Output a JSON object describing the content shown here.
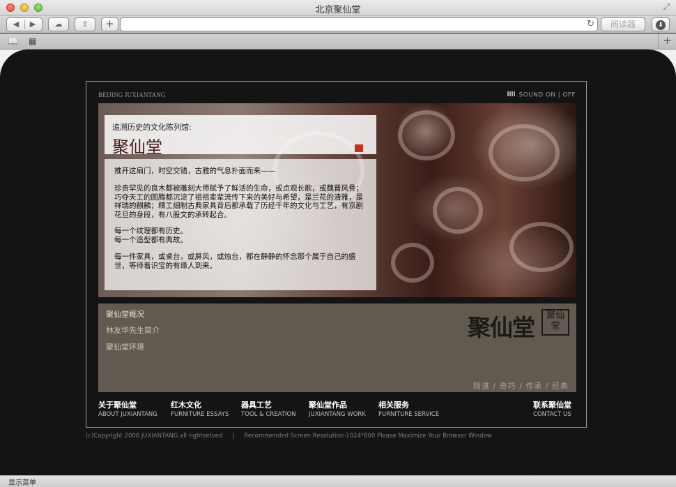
{
  "window": {
    "title": "北京聚仙堂"
  },
  "toolbar": {
    "back_icon": "◀",
    "forward_icon": "▶",
    "cloud_icon": "☁",
    "share_icon": "⇪",
    "add_icon": "+",
    "address_value": "",
    "reload_icon": "↻",
    "reader_label": "阅读器",
    "download_icon": "⬇"
  },
  "bookmarks": {
    "book_icon": "📖",
    "grid_icon": "▦",
    "newtab_icon": "+"
  },
  "site": {
    "brand_small": "BEIJING JUXIANTANG",
    "sound_label": "SOUND ON | OFF",
    "hero": {
      "subtitle": "追溯历史的文化陈列馆:",
      "title": "聚仙堂",
      "paragraphs": [
        "推开这扇门，时空交错，古雅的气息扑面而来——",
        "珍贵罕见的良木都被雕刻大师赋予了鲜活的生命，或贞观长歌，或魏晋风骨；巧夺天工的图腾都沉淀了祖祖辈辈流传下来的美好与希望，是兰花的清雅，是祥瑞的麒麟；精工细制古典家具背后都承载了历经千年的文化与工艺，有京剧花旦的身段，有八股文的承转起合。",
        "每一个纹理都有历史。\n每一个造型都有典故。",
        "每一件家具，或桌台，或屏风，或烛台，都在静静的怀念那个属于自己的盛世，等待着识宝的有缘人到来。"
      ]
    },
    "submenu": [
      "聚仙堂概况",
      "林友华先生简介",
      "聚仙堂环境"
    ],
    "logo_text": "聚仙堂",
    "seal_text": "聚仙堂",
    "tagline": "精湛 / 奇巧 / 传承 / 经典",
    "nav": [
      {
        "cn": "关于聚仙堂",
        "en": "ABOUT JUXIANTANG"
      },
      {
        "cn": "红木文化",
        "en": "FURNITURE ESSAYS"
      },
      {
        "cn": "器具工艺",
        "en": "TOOL & CREATION"
      },
      {
        "cn": "聚仙堂作品",
        "en": "JUXIANTANG WORK"
      },
      {
        "cn": "相关服务",
        "en": "FURNITURE SERVICE"
      },
      {
        "cn": "联系聚仙堂",
        "en": "CONTACT US"
      }
    ],
    "footer": {
      "copyright": "(c)Copyright 2008 JUXIANTANG all rightsetved",
      "separator": "|",
      "note": "Recommended Screen Resolution-1024*800  Please Maximize Your Browser Window"
    }
  },
  "statusbar": {
    "label": "显示菜单"
  },
  "colors": {
    "accent_red": "#c8321c",
    "panel": "#615a50",
    "background": "#141414"
  }
}
